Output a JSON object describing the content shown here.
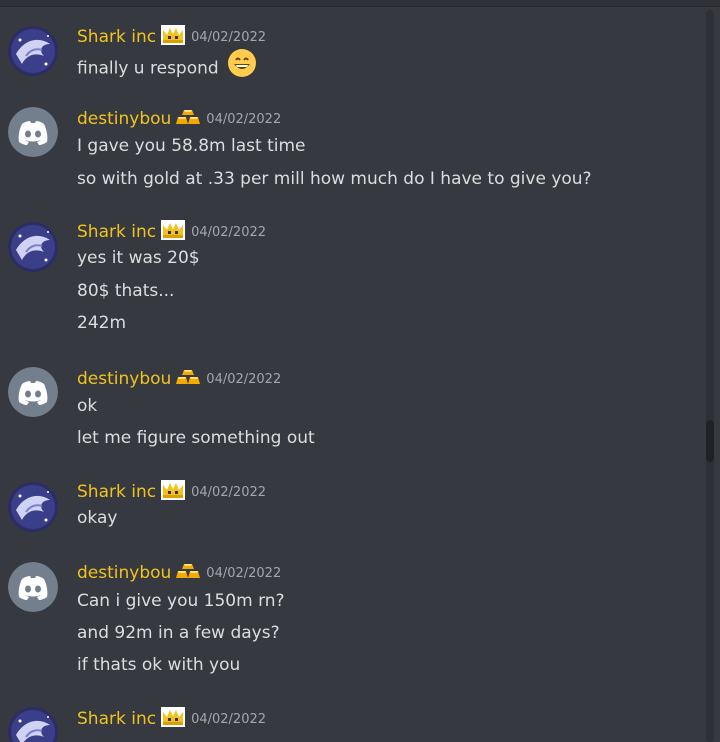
{
  "messages": [
    {
      "user": "Shark inc",
      "avatar": "shark-avatar",
      "badge": "crown-icon",
      "timestamp": "04/02/2022",
      "lines": [
        "finally u respond"
      ],
      "emoji": "grinning-face-emoji"
    },
    {
      "user": "destinybou",
      "avatar": "discord-avatar",
      "badge": "gold-bars-icon",
      "timestamp": "04/02/2022",
      "lines": [
        "I gave you 58.8m last time",
        "so with gold at .33 per mill how much do I have to give you?"
      ]
    },
    {
      "user": "Shark inc",
      "avatar": "shark-avatar",
      "badge": "crown-icon",
      "timestamp": "04/02/2022",
      "lines": [
        "yes it was 20$",
        "80$ thats...",
        "242m"
      ]
    },
    {
      "user": "destinybou",
      "avatar": "discord-avatar",
      "badge": "gold-bars-icon",
      "timestamp": "04/02/2022",
      "lines": [
        "ok",
        "let me figure something out"
      ]
    },
    {
      "user": "Shark inc",
      "avatar": "shark-avatar",
      "badge": "crown-icon",
      "timestamp": "04/02/2022",
      "lines": [
        "okay"
      ]
    },
    {
      "user": "destinybou",
      "avatar": "discord-avatar",
      "badge": "gold-bars-icon",
      "timestamp": "04/02/2022",
      "lines": [
        "Can i give you 150m rn?",
        "and 92m in a few days?",
        "if thats ok with you"
      ]
    },
    {
      "user": "Shark inc",
      "avatar": "shark-avatar",
      "badge": "crown-icon",
      "timestamp": "04/02/2022",
      "lines": []
    }
  ],
  "colors": {
    "background": "#36393f",
    "username": "#f2c31f",
    "text": "#dcddde",
    "timestamp": "#a3a6aa"
  }
}
